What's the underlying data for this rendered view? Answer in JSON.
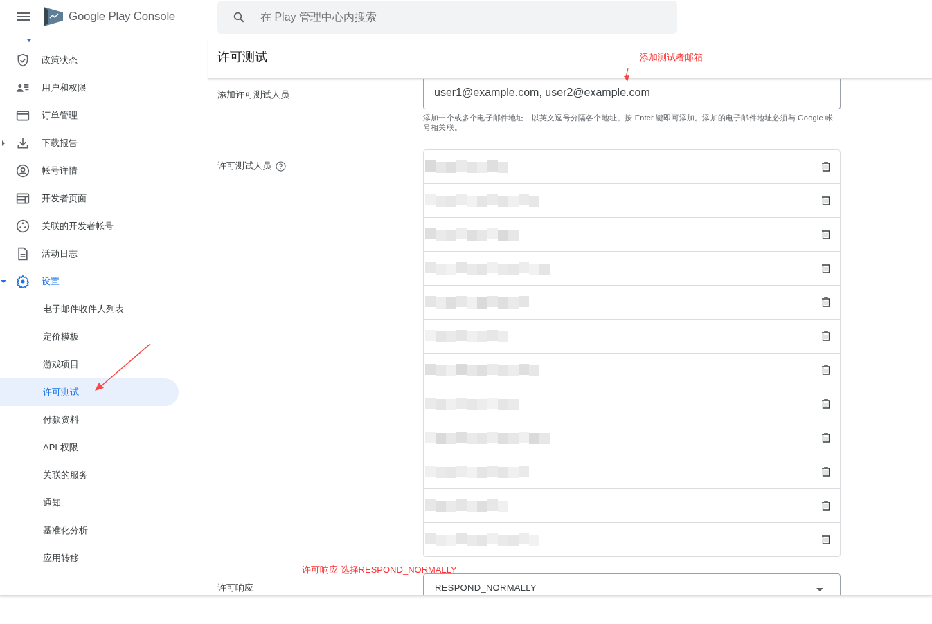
{
  "header": {
    "brand": "Google Play Console",
    "search": {
      "placeholder": "在 Play 管理中心内搜索"
    }
  },
  "sidebar": {
    "items": [
      {
        "label": "政策状态",
        "selected": false
      },
      {
        "label": "用户和权限",
        "selected": false
      },
      {
        "label": "订单管理",
        "selected": false
      },
      {
        "label": "下载报告",
        "selected": false,
        "expanded": false
      },
      {
        "label": "帐号详情",
        "selected": false
      },
      {
        "label": "开发者页面",
        "selected": false
      },
      {
        "label": "关联的开发者帐号",
        "selected": false
      },
      {
        "label": "活动日志",
        "selected": false
      },
      {
        "label": "设置",
        "selected": true,
        "expanded": true,
        "children": [
          {
            "label": "电子邮件收件人列表",
            "selected": false
          },
          {
            "label": "定价模板",
            "selected": false
          },
          {
            "label": "游戏项目",
            "selected": false
          },
          {
            "label": "许可测试",
            "selected": true
          },
          {
            "label": "付款资料",
            "selected": false
          },
          {
            "label": "API 权限",
            "selected": false
          },
          {
            "label": "关联的服务",
            "selected": false
          },
          {
            "label": "通知",
            "selected": false
          },
          {
            "label": "基准化分析",
            "selected": false
          },
          {
            "label": "应用转移",
            "selected": false
          }
        ]
      }
    ]
  },
  "page": {
    "title": "许可测试",
    "add_testers": {
      "label": "添加许可测试人员",
      "value": "user1@example.com, user2@example.com",
      "hint": "添加一个或多个电子邮件地址，以英文逗号分隔各个地址。按 Enter 键即可添加。添加的电子邮件地址必须与 Google 帐号相关联。"
    },
    "testers": {
      "label": "许可测试人员",
      "rows": [
        {
          "kind": "redacted"
        },
        {
          "kind": "redacted"
        },
        {
          "kind": "redacted"
        },
        {
          "kind": "redacted"
        },
        {
          "kind": "redacted"
        },
        {
          "kind": "redacted"
        },
        {
          "kind": "redacted"
        },
        {
          "kind": "redacted"
        },
        {
          "kind": "redacted"
        },
        {
          "kind": "redacted"
        },
        {
          "kind": "redacted"
        },
        {
          "kind": "redacted"
        }
      ]
    },
    "license_response": {
      "label": "许可响应",
      "value": "RESPOND_NORMALLY"
    }
  },
  "annotations": [
    {
      "text": "添加测试者邮箱"
    },
    {
      "text": "许可响应 选择RESPOND_NORMALLY"
    }
  ]
}
